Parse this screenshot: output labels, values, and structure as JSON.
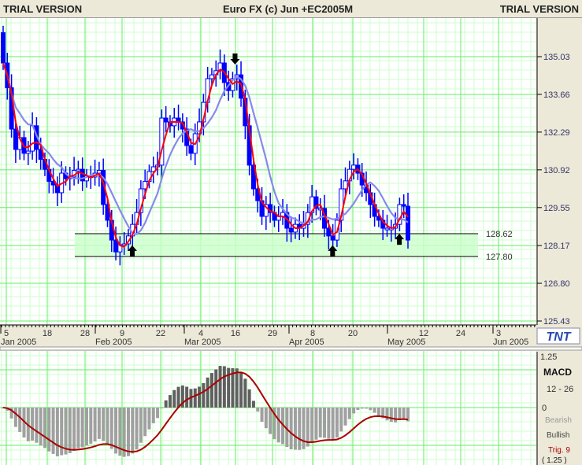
{
  "header": {
    "left": "TRIAL VERSION",
    "center": "Euro FX (c)  Jun +EC2005M",
    "right": "TRIAL VERSION"
  },
  "colors": {
    "up": "#ffffff",
    "down": "#0000ff",
    "fast_ma": "#ff0000",
    "slow_ma": "#8888ee",
    "band": "#ccffcc",
    "macd_bar": "#808080",
    "signal": "#aa0000"
  },
  "chart_data": [
    {
      "type": "candlestick",
      "title": "Euro FX (c)  Jun +EC2005M",
      "first_open": 135.9,
      "closes": [
        134.8,
        133.9,
        132.4,
        131.66,
        132.09,
        131.52,
        131.6,
        132.52,
        131.66,
        131.3,
        130.94,
        130.5,
        130.37,
        130.09,
        130.8,
        130.6,
        130.66,
        130.9,
        130.94,
        130.52,
        130.7,
        130.66,
        130.8,
        130.9,
        129.66,
        129.09,
        128.37,
        127.94,
        128.2,
        128.23,
        128.52,
        128.94,
        129.37,
        130.23,
        130.5,
        130.86,
        131.03,
        131.09,
        132.8,
        132.66,
        132.52,
        132.8,
        132.66,
        132.4,
        131.8,
        131.52,
        132.23,
        132.66,
        133.37,
        134.23,
        134.37,
        134.52,
        134.8,
        134.09,
        133.8,
        134.23,
        134.37,
        133.52,
        132.52,
        131.09,
        130.23,
        129.8,
        129.23,
        129.66,
        129.37,
        129.09,
        129.23,
        129.37,
        128.8,
        128.66,
        128.94,
        128.8,
        128.94,
        129.37,
        129.94,
        129.52,
        129.52,
        128.8,
        128.52,
        128.37,
        129.09,
        130.23,
        130.52,
        130.94,
        131.09,
        130.8,
        130.37,
        130.09,
        129.66,
        129.23,
        129.09,
        128.8,
        128.8,
        128.8,
        128.94,
        129.66,
        129.6,
        128.37
      ],
      "ylim": [
        125.0,
        136.0
      ],
      "y_ticks": [
        "135.03",
        "133.66",
        "132.29",
        "130.92",
        "129.55",
        "128.17",
        "126.80",
        "125.43"
      ],
      "x_ticks": [
        "5",
        "18",
        "28",
        "9",
        "22",
        "4",
        "16",
        "29",
        "8",
        "20",
        "12",
        "24",
        "3"
      ],
      "months": [
        "Jan 2005",
        "Feb 2005",
        "Mar 2005",
        "Apr 2005",
        "May 2005",
        "Jun 2005"
      ],
      "levels": [
        "128.62",
        "127.80"
      ],
      "buy_arrows": [
        30,
        78,
        94
      ],
      "sell_arrows": [
        55
      ],
      "fast_ma": 3,
      "slow_ma": 8
    },
    {
      "type": "bar",
      "title": "MACD",
      "params": "12 - 26",
      "ylim": [
        -1.25,
        1.25
      ],
      "y_ticks": [
        "1.25",
        "0",
        "( 1.25 )"
      ],
      "legend": [
        "Bearish",
        "Bullish"
      ],
      "trigger": "Trig. 9"
    }
  ],
  "logo": "TNT"
}
